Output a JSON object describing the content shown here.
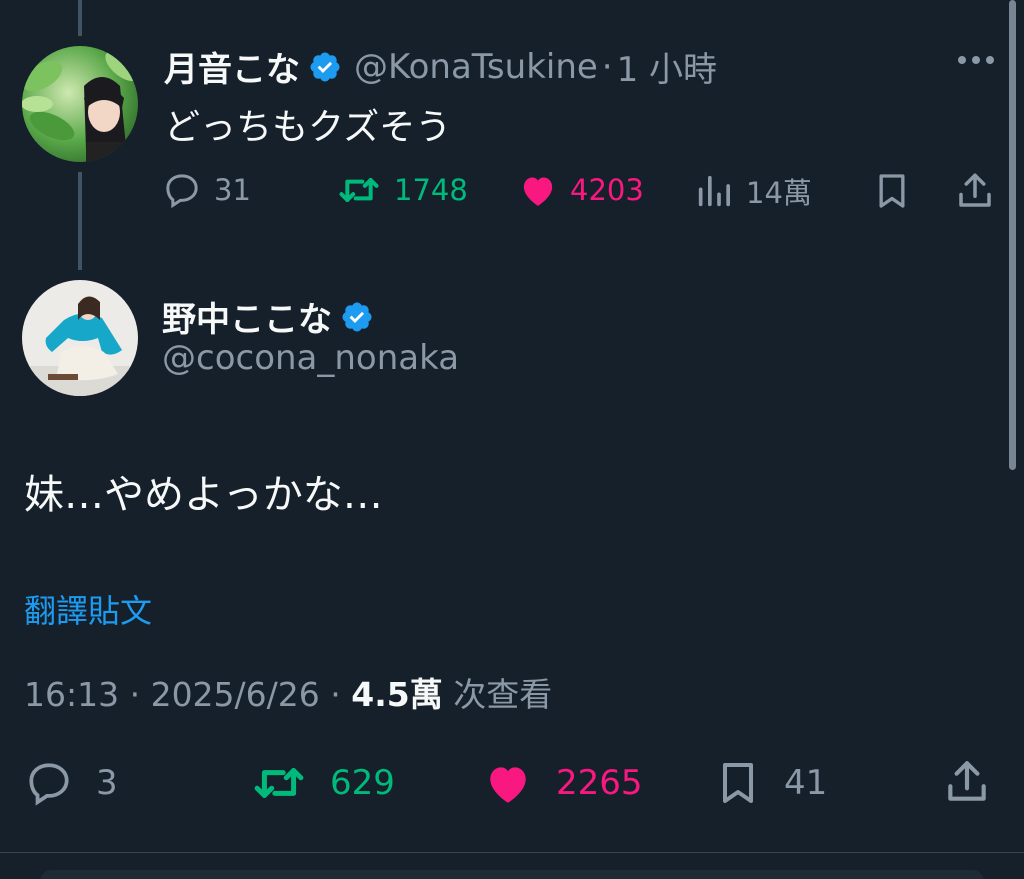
{
  "reply": {
    "display_name": "月音こな",
    "handle": "@KonaTsukine",
    "separator": "·",
    "time": "1 小時",
    "text": "どっちもクズそう",
    "actions": {
      "replies": "31",
      "reposts": "1748",
      "likes": "4203",
      "views": "14萬"
    }
  },
  "main": {
    "display_name": "野中ここな",
    "handle": "@cocona_nonaka",
    "text": "妹…やめよっかな…",
    "translate_label": "翻譯貼文",
    "timestamp": "16:13 · 2025/6/26 · ",
    "views_count": "4.5萬",
    "views_suffix": " 次查看",
    "actions": {
      "replies": "3",
      "reposts": "629",
      "likes": "2265",
      "bookmarks": "41"
    }
  },
  "icons": {
    "verified": "verified-badge-icon",
    "reply": "reply-icon",
    "repost": "repost-icon",
    "like": "heart-icon",
    "views": "views-icon",
    "bookmark": "bookmark-icon",
    "share": "share-icon",
    "more": "more-icon"
  },
  "colors": {
    "background": "#15202b",
    "verified": "#1d9bf0",
    "link": "#1d9bf0",
    "repost": "#00ba7c",
    "like": "#f91880",
    "muted": "#8b98a5"
  }
}
